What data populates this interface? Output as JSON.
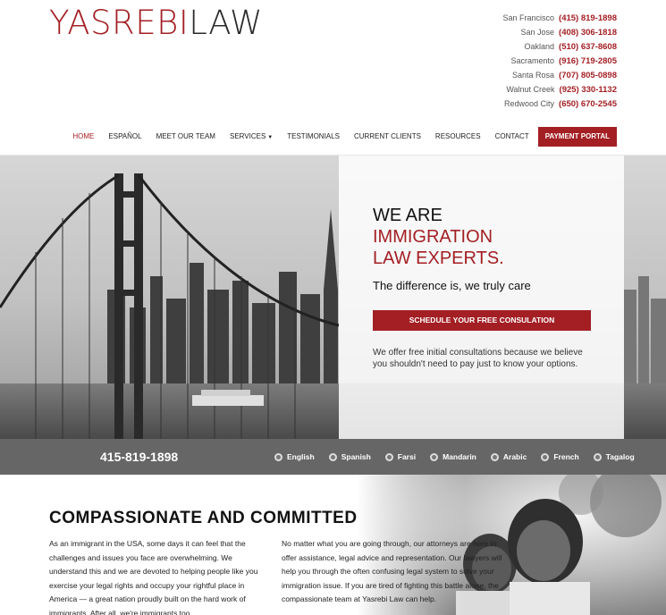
{
  "brand": {
    "part1": "YASREBI",
    "part2": "LAW",
    "primary": "#a31f24"
  },
  "offices": [
    {
      "city": "San Francisco",
      "phone": "(415) 819-1898"
    },
    {
      "city": "San Jose",
      "phone": "(408) 306-1818"
    },
    {
      "city": "Oakland",
      "phone": "(510) 637-8608"
    },
    {
      "city": "Sacramento",
      "phone": "(916) 719-2805"
    },
    {
      "city": "Santa Rosa",
      "phone": "(707) 805-0898"
    },
    {
      "city": "Walnut Creek",
      "phone": "(925) 330-1132"
    },
    {
      "city": "Redwood City",
      "phone": "(650) 670-2545"
    }
  ],
  "nav": {
    "home": "HOME",
    "espanol": "ESPAÑOL",
    "team": "MEET OUR TEAM",
    "services": "SERVICES",
    "testimonials": "TESTIMONIALS",
    "clients": "CURRENT CLIENTS",
    "resources": "RESOURCES",
    "contact": "CONTACT",
    "payment": "PAYMENT PORTAL"
  },
  "hero": {
    "line1": "WE ARE",
    "line2": "IMMIGRATION",
    "line3": "LAW EXPERTS.",
    "tagline": "The difference is, we truly care",
    "button": "SCHEDULE YOUR FREE CONSULATION",
    "description": "We offer free initial consultations because we believe you shouldn't need to pay just to know your options."
  },
  "bar": {
    "phone": "415-819-1898",
    "languages": [
      "English",
      "Spanish",
      "Farsi",
      "Mandarin",
      "Arabic",
      "French",
      "Tagalog"
    ]
  },
  "section": {
    "title": "COMPASSIONATE AND COMMITTED",
    "col1": "As an immigrant in the USA, some days it can feel that the challenges and issues you face are overwhelming. We understand this and we are devoted to helping people like you exercise your legal rights and occupy your rightful place in America — a great nation proudly built on the hard work of immigrants. After all, we're immigrants too.",
    "col2": "No matter what you are going through, our attorneys are here to offer assistance, legal advice and representation. Our lawyers will help you through the often confusing legal system to solve your immigration issue. If you are tired of fighting this battle alone, the compassionate team at Yasrebi Law can help."
  }
}
